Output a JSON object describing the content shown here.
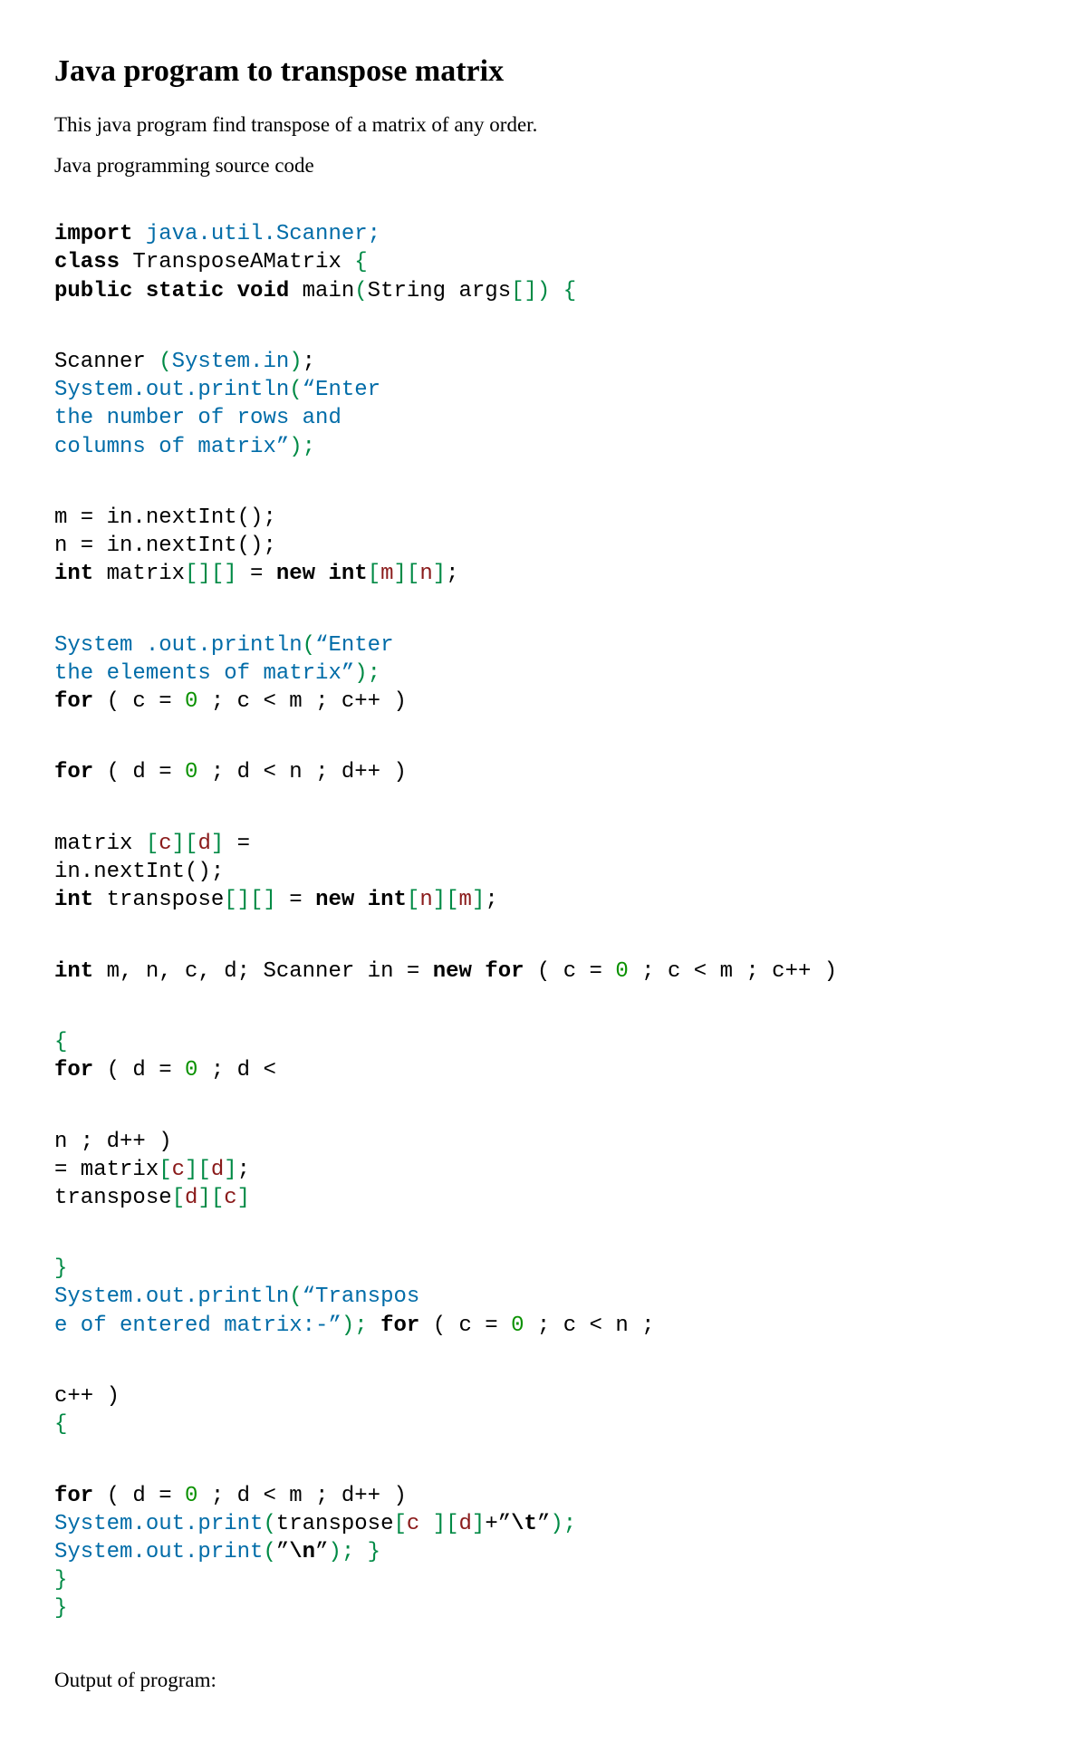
{
  "heading": "Java program to transpose matrix",
  "intro": "This java program find transpose of a matrix of any order.",
  "caption": "Java programming source code",
  "c": {
    "l1a": "import",
    "l1b": " java.util.Scanner;",
    "l2a": "class",
    "l2b": " TransposeAMatrix ",
    "l2c": "{",
    "l3a": "public static void",
    "l3b": " main",
    "l3c": "(",
    "l3d": "String args",
    "l3e": "[]) {",
    "l4a": "Scanner ",
    "l4b": "(",
    "l4c": "System.in",
    "l4d": ")",
    "l4e": ";",
    "l5a": "System.out.println",
    "l5b": "(",
    "l5c": "“Enter",
    "l6": "the number of rows and",
    "l7a": "columns of matrix”",
    "l7b": ");",
    "l8": "m = in.nextInt();",
    "l9": "n = in.nextInt();",
    "l10a": "int",
    "l10b": " matrix",
    "l10c": "[][]",
    "l10d": " = ",
    "l10e": "new int",
    "l10f": "[",
    "l10g": "m",
    "l10h": "][",
    "l10i": "n",
    "l10j": "]",
    "l10k": ";",
    "l11a": "System .out.println",
    "l11b": "(",
    "l11c": "“Enter",
    "l12a": "the elements of matrix”",
    "l12b": ");",
    "l13a": "for",
    "l13b": " ( c = ",
    "l13c": "0",
    "l13d": " ; c < m ; c++ )",
    "l14a": "for",
    "l14b": " ( d = ",
    "l14c": "0",
    "l14d": " ; d < n ; d++ )",
    "l15a": "matrix ",
    "l15b": "[",
    "l15c": "c",
    "l15d": "][",
    "l15e": "d",
    "l15f": "]",
    "l15g": " =",
    "l16": "in.nextInt();",
    "l17a": "int",
    "l17b": " transpose",
    "l17c": "[][]",
    "l17d": " = ",
    "l17e": "new int",
    "l17f": "[",
    "l17g": "n",
    "l17h": "][",
    "l17i": "m",
    "l17j": "]",
    "l17k": ";",
    "l18a": "int",
    "l18b": " m, n, c, d; Scanner in = ",
    "l18c": "new for",
    "l18d": " ( c = ",
    "l18e": "0",
    "l18f": " ; c < m ; c++ )",
    "l19": "{",
    "l20a": "for",
    "l20b": " ( d = ",
    "l20c": "0",
    "l20d": " ; d <",
    "l21a": "n ; d++ )",
    "l22a": "= matrix",
    "l22b": "[",
    "l22c": "c",
    "l22d": "][",
    "l22e": "d",
    "l22f": "]",
    "l22g": ";",
    "l23a": "transpose",
    "l23b": "[",
    "l23c": "d",
    "l23d": "][",
    "l23e": "c",
    "l23f": "]",
    "l24": "}",
    "l25a": "System.out.println",
    "l25b": "(",
    "l25c": "“Transpos",
    "l26a": "e of entered matrix:-”",
    "l26b": ");",
    "l26c": " ",
    "l26d": "for",
    "l26e": " ( c = ",
    "l26f": "0",
    "l26g": " ; c < n ;",
    "l27a": "c++ )",
    "l28": "{",
    "l29a": "for",
    "l29b": " ( d = ",
    "l29c": "0",
    "l29d": " ; d < m ; d++ )",
    "l30a": "System.out.print",
    "l30b": "(",
    "l30c": "transpose",
    "l30d": "[",
    "l30e": "c ",
    "l30f": "][",
    "l30g": "d",
    "l30h": "]",
    "l30i": "+”",
    "l30j": "\\t",
    "l30k": "”",
    "l30l": ");",
    "l31a": "System.out.print",
    "l31b": "(",
    "l31c": "”",
    "l31d": "\\n",
    "l31e": "”",
    "l31f": ");",
    "l31g": " }",
    "l32": "}",
    "l33": "}"
  },
  "outcap": "Output of program:"
}
